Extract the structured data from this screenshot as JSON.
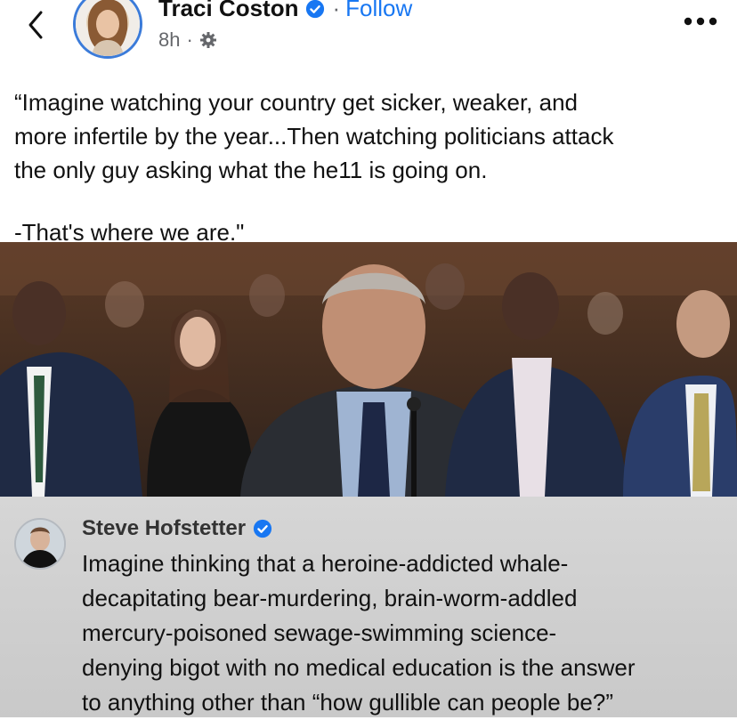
{
  "post": {
    "author": "Traci Coston",
    "separator": "·",
    "follow_label": "Follow",
    "time": "8h",
    "meta_separator": "·",
    "privacy_icon": "gear-icon",
    "paragraphs": [
      "“Imagine watching your country get sicker, weaker, and\nmore infertile by the year...Then watching politicians attack\nthe only guy asking what the he11 is going on.",
      "-That's where we are.\""
    ]
  },
  "comment": {
    "author": "Steve Hofstetter",
    "text": "Imagine thinking that a heroine-addicted whale-\ndecapitating bear-murdering, brain-worm-addled\nmercury-poisoned sewage-swimming science-\ndenying bigot with no medical education is the answer\nto anything other than “how gullible can people be?”"
  },
  "colors": {
    "accent": "#1877f2",
    "verified": "#1877f2",
    "comment_bg": "#d0d0d0"
  }
}
